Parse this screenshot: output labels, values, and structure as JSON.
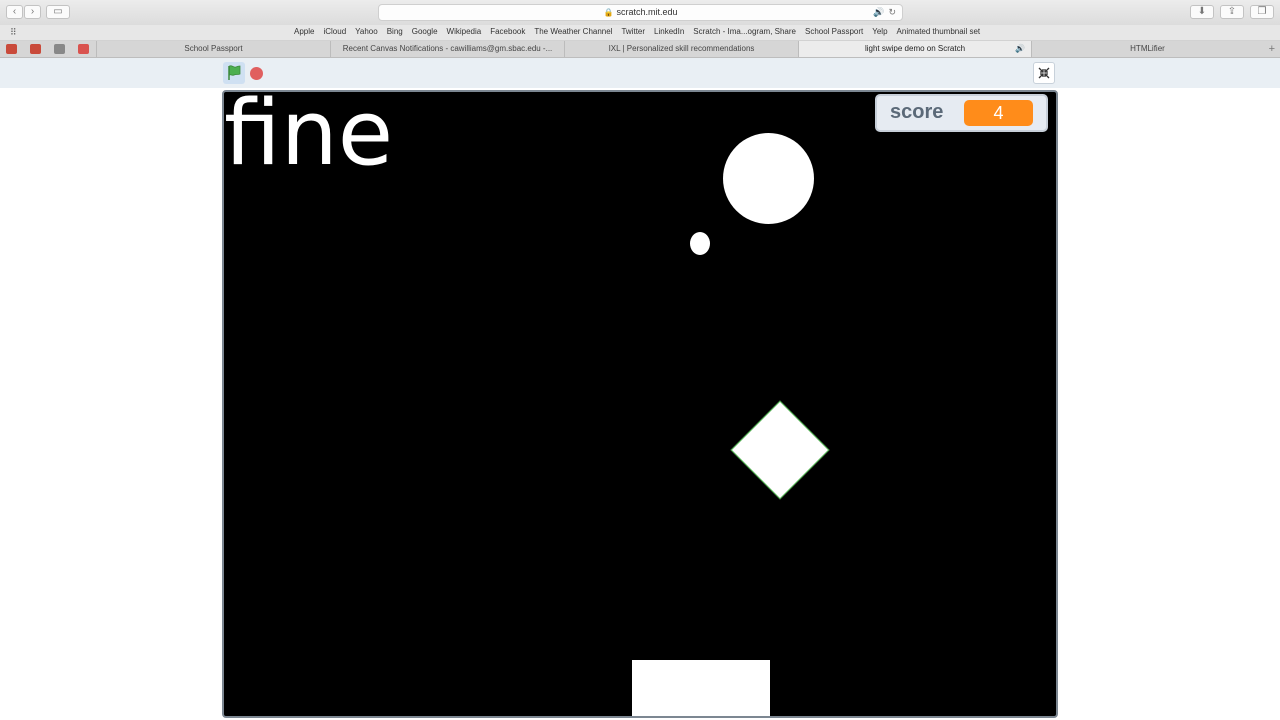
{
  "browser": {
    "url": "scratch.mit.edu",
    "bookmarks": [
      "Apple",
      "iCloud",
      "Yahoo",
      "Bing",
      "Google",
      "Wikipedia",
      "Facebook",
      "The Weather Channel",
      "Twitter",
      "LinkedIn",
      "Scratch - Ima...ogram, Share",
      "School Passport",
      "Yelp",
      "Animated thumbnail set"
    ],
    "tabs": [
      {
        "label": "School Passport"
      },
      {
        "label": "Recent Canvas Notifications - cawilliams@gm.sbac.edu -..."
      },
      {
        "label": "IXL | Personalized skill recommendations"
      },
      {
        "label": "light swipe demo on Scratch"
      },
      {
        "label": "HTMLifier"
      }
    ],
    "add_tab": "+"
  },
  "stage": {
    "say_text": "fine",
    "monitor": {
      "label": "score",
      "value": "4"
    }
  },
  "icons": {
    "flag": "green-flag-icon",
    "stop": "stop-icon",
    "fullscreen": "exit-fullscreen-icon"
  },
  "colors": {
    "stage_bg": "#000000",
    "monitor_value": "#ff8c1a",
    "stop": "#e05f5f",
    "flag": "#4caf50"
  }
}
